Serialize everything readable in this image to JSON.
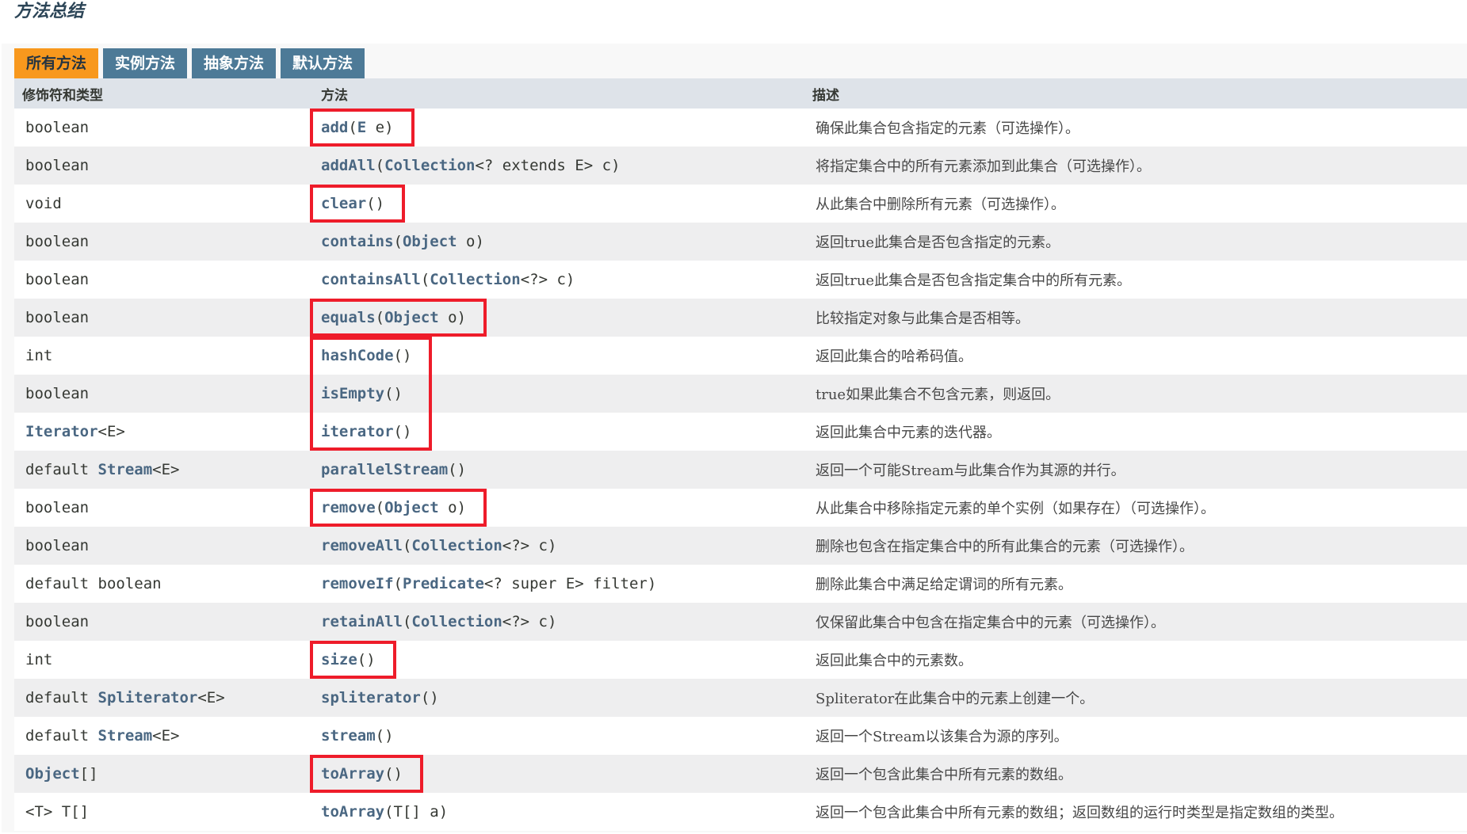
{
  "title": "方法总结",
  "tabs": [
    {
      "label": "所有方法",
      "active": true
    },
    {
      "label": "实例方法",
      "active": false
    },
    {
      "label": "抽象方法",
      "active": false
    },
    {
      "label": "默认方法",
      "active": false
    }
  ],
  "columns": [
    "修饰符和类型",
    "方法",
    "描述"
  ],
  "colors": {
    "active_tab": "#f8981d",
    "tab": "#4d7a97",
    "link": "#4a6782",
    "highlight": "#ee1c2a"
  },
  "rows": [
    {
      "mod_pre": "",
      "mod_link": "",
      "mod_post": "boolean",
      "name": "add",
      "params_pre": "(",
      "params_link": "E",
      "params_post": " e)",
      "desc": "确保此集合包含指定的元素（可选操作）。",
      "highlighted": true
    },
    {
      "mod_pre": "",
      "mod_link": "",
      "mod_post": "boolean",
      "name": "addAll",
      "params_pre": "(",
      "params_link": "Collection",
      "params_post": "<? extends E> c)",
      "desc": "将指定集合中的所有元素添加到此集合（可选操作）。",
      "highlighted": false
    },
    {
      "mod_pre": "",
      "mod_link": "",
      "mod_post": "void",
      "name": "clear",
      "params_pre": "()",
      "params_link": "",
      "params_post": "",
      "desc": "从此集合中删除所有元素（可选操作）。",
      "highlighted": true
    },
    {
      "mod_pre": "",
      "mod_link": "",
      "mod_post": "boolean",
      "name": "contains",
      "params_pre": "(",
      "params_link": "Object",
      "params_post": " o)",
      "desc": "返回true此集合是否包含指定的元素。",
      "highlighted": false
    },
    {
      "mod_pre": "",
      "mod_link": "",
      "mod_post": "boolean",
      "name": "containsAll",
      "params_pre": "(",
      "params_link": "Collection",
      "params_post": "<?> c)",
      "desc": "返回true此集合是否包含指定集合中的所有元素。",
      "highlighted": false
    },
    {
      "mod_pre": "",
      "mod_link": "",
      "mod_post": "boolean",
      "name": "equals",
      "params_pre": "(",
      "params_link": "Object",
      "params_post": " o)",
      "desc": "比较指定对象与此集合是否相等。",
      "highlighted": true
    },
    {
      "mod_pre": "",
      "mod_link": "",
      "mod_post": "int",
      "name": "hashCode",
      "params_pre": "()",
      "params_link": "",
      "params_post": "",
      "desc": "返回此集合的哈希码值。",
      "highlighted": true
    },
    {
      "mod_pre": "",
      "mod_link": "",
      "mod_post": "boolean",
      "name": "isEmpty",
      "params_pre": "()",
      "params_link": "",
      "params_post": "",
      "desc": "true如果此集合不包含元素，则返回。",
      "highlighted": true
    },
    {
      "mod_pre": "",
      "mod_link": "Iterator",
      "mod_post": "<E>",
      "name": "iterator",
      "params_pre": "()",
      "params_link": "",
      "params_post": "",
      "desc": "返回此集合中元素的迭代器。",
      "highlighted": true
    },
    {
      "mod_pre": "default ",
      "mod_link": "Stream",
      "mod_post": "<E>",
      "name": "parallelStream",
      "params_pre": "()",
      "params_link": "",
      "params_post": "",
      "desc": "返回一个可能Stream与此集合作为其源的并行。",
      "highlighted": false
    },
    {
      "mod_pre": "",
      "mod_link": "",
      "mod_post": "boolean",
      "name": "remove",
      "params_pre": "(",
      "params_link": "Object",
      "params_post": " o)",
      "desc": "从此集合中移除指定元素的单个实例（如果存在）（可选操作）。",
      "highlighted": true
    },
    {
      "mod_pre": "",
      "mod_link": "",
      "mod_post": "boolean",
      "name": "removeAll",
      "params_pre": "(",
      "params_link": "Collection",
      "params_post": "<?> c)",
      "desc": "删除也包含在指定集合中的所有此集合的元素（可选操作）。",
      "highlighted": false
    },
    {
      "mod_pre": "",
      "mod_link": "",
      "mod_post": "default boolean",
      "name": "removeIf",
      "params_pre": "(",
      "params_link": "Predicate",
      "params_post": "<? super E> filter)",
      "desc": "删除此集合中满足给定谓词的所有元素。",
      "highlighted": false
    },
    {
      "mod_pre": "",
      "mod_link": "",
      "mod_post": "boolean",
      "name": "retainAll",
      "params_pre": "(",
      "params_link": "Collection",
      "params_post": "<?> c)",
      "desc": "仅保留此集合中包含在指定集合中的元素（可选操作）。",
      "highlighted": false
    },
    {
      "mod_pre": "",
      "mod_link": "",
      "mod_post": "int",
      "name": "size",
      "params_pre": "()",
      "params_link": "",
      "params_post": "",
      "desc": "返回此集合中的元素数。",
      "highlighted": true
    },
    {
      "mod_pre": "default ",
      "mod_link": "Spliterator",
      "mod_post": "<E>",
      "name": "spliterator",
      "params_pre": "()",
      "params_link": "",
      "params_post": "",
      "desc": "Spliterator在此集合中的元素上创建一个。",
      "highlighted": false
    },
    {
      "mod_pre": "default ",
      "mod_link": "Stream",
      "mod_post": "<E>",
      "name": "stream",
      "params_pre": "()",
      "params_link": "",
      "params_post": "",
      "desc": "返回一个Stream以该集合为源的序列。",
      "highlighted": false
    },
    {
      "mod_pre": "",
      "mod_link": "Object",
      "mod_post": "[]",
      "name": "toArray",
      "params_pre": "()",
      "params_link": "",
      "params_post": "",
      "desc": "返回一个包含此集合中所有元素的数组。",
      "highlighted": true
    },
    {
      "mod_pre": "",
      "mod_link": "",
      "mod_post": "<T> T[]",
      "name": "toArray",
      "params_pre": "(T[] a)",
      "params_link": "",
      "params_post": "",
      "desc": "返回一个包含此集合中所有元素的数组；返回数组的运行时类型是指定数组的类型。",
      "highlighted": false
    }
  ]
}
